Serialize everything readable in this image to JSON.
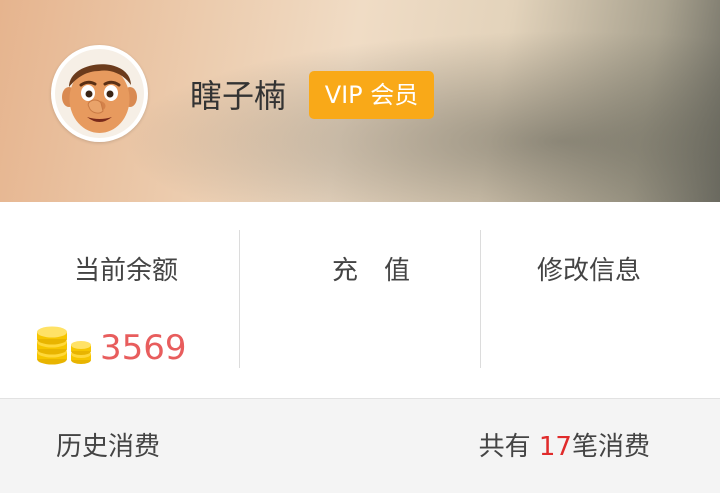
{
  "profile": {
    "username": "瞎子楠",
    "vip_label": "VIP 会员"
  },
  "stats": {
    "balance_label": "当前余额",
    "balance_value": "3569",
    "recharge_label": "充　值",
    "edit_info_label": "修改信息"
  },
  "history": {
    "label": "历史消费",
    "count_prefix": "共有 ",
    "count_value": "17",
    "count_suffix": "笔消费"
  },
  "colors": {
    "vip_badge": "#f9a918",
    "balance": "#e85d5d",
    "count_highlight": "#e02b2b",
    "coin": "#f6c500"
  },
  "icons": {
    "avatar": "cartoon-boy-avatar",
    "coins": "gold-coins-icon"
  }
}
